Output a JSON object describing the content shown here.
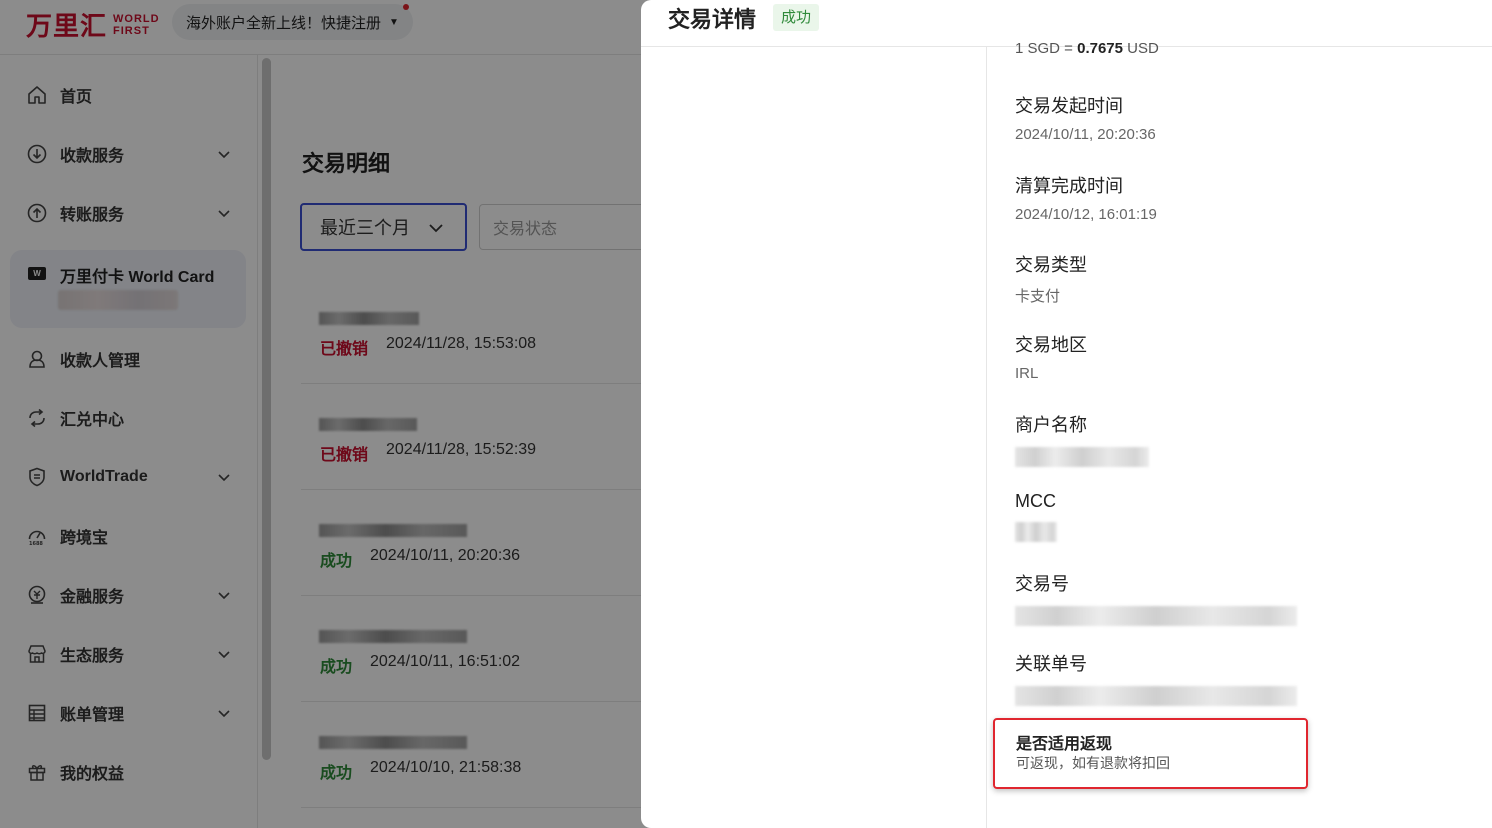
{
  "header": {
    "logo_cn": "万里汇",
    "logo_en_1": "WORLD",
    "logo_en_2": "FIRST",
    "promo_text": "海外账户全新上线！快捷注册"
  },
  "sidebar": {
    "items": [
      {
        "label": "首页",
        "icon": "home-icon"
      },
      {
        "label": "收款服务",
        "icon": "download-circle-icon",
        "expandable": true
      },
      {
        "label": "转账服务",
        "icon": "upload-circle-icon",
        "expandable": true
      },
      {
        "label": "万里付卡 World Card",
        "icon": "card-w-icon",
        "selected": true
      },
      {
        "label": "收款人管理",
        "icon": "user-icon"
      },
      {
        "label": "汇兑中心",
        "icon": "exchange-icon"
      },
      {
        "label": "WorldTrade",
        "icon": "shield-icon",
        "expandable": true
      },
      {
        "label": "跨境宝",
        "icon": "gauge-icon"
      },
      {
        "label": "金融服务",
        "icon": "finance-icon",
        "expandable": true
      },
      {
        "label": "生态服务",
        "icon": "store-icon",
        "expandable": true
      },
      {
        "label": "账单管理",
        "icon": "bill-icon",
        "expandable": true
      },
      {
        "label": "我的权益",
        "icon": "gift-icon"
      }
    ],
    "card_badge": "W"
  },
  "main": {
    "title": "交易明细",
    "range_filter": "最近三个月",
    "status_placeholder": "交易状态",
    "transactions": [
      {
        "status": "已撤销",
        "status_color": "#c8102e",
        "time": "2024/11/28, 15:53:08"
      },
      {
        "status": "已撤销",
        "status_color": "#c8102e",
        "time": "2024/11/28, 15:52:39"
      },
      {
        "status": "成功",
        "status_color": "#2f8a3a",
        "time": "2024/10/11, 20:20:36"
      },
      {
        "status": "成功",
        "status_color": "#2f8a3a",
        "time": "2024/10/11, 16:51:02"
      },
      {
        "status": "成功",
        "status_color": "#2f8a3a",
        "time": "2024/10/10, 21:58:38"
      }
    ]
  },
  "drawer": {
    "title": "交易详情",
    "status_badge": "成功",
    "rate_prefix": "1 SGD = ",
    "rate_value": "0.7675",
    "rate_suffix": " USD",
    "fields": [
      {
        "label": "交易发起时间",
        "value": "2024/10/11, 20:20:36"
      },
      {
        "label": "清算完成时间",
        "value": "2024/10/12, 16:01:19"
      },
      {
        "label": "交易类型",
        "value": "卡支付"
      },
      {
        "label": "交易地区",
        "value": "IRL"
      },
      {
        "label": "商户名称",
        "value": ""
      },
      {
        "label": "MCC",
        "value": ""
      },
      {
        "label": "交易号",
        "value": ""
      },
      {
        "label": "关联单号",
        "value": ""
      }
    ],
    "cashback": {
      "title": "是否适用返现",
      "desc": "可返现，如有退款将扣回"
    }
  },
  "colors": {
    "brand_red": "#c8102e",
    "accent_blue": "#3b4fd1",
    "success_green": "#2f8a3a",
    "highlight_red": "#e0262f"
  }
}
